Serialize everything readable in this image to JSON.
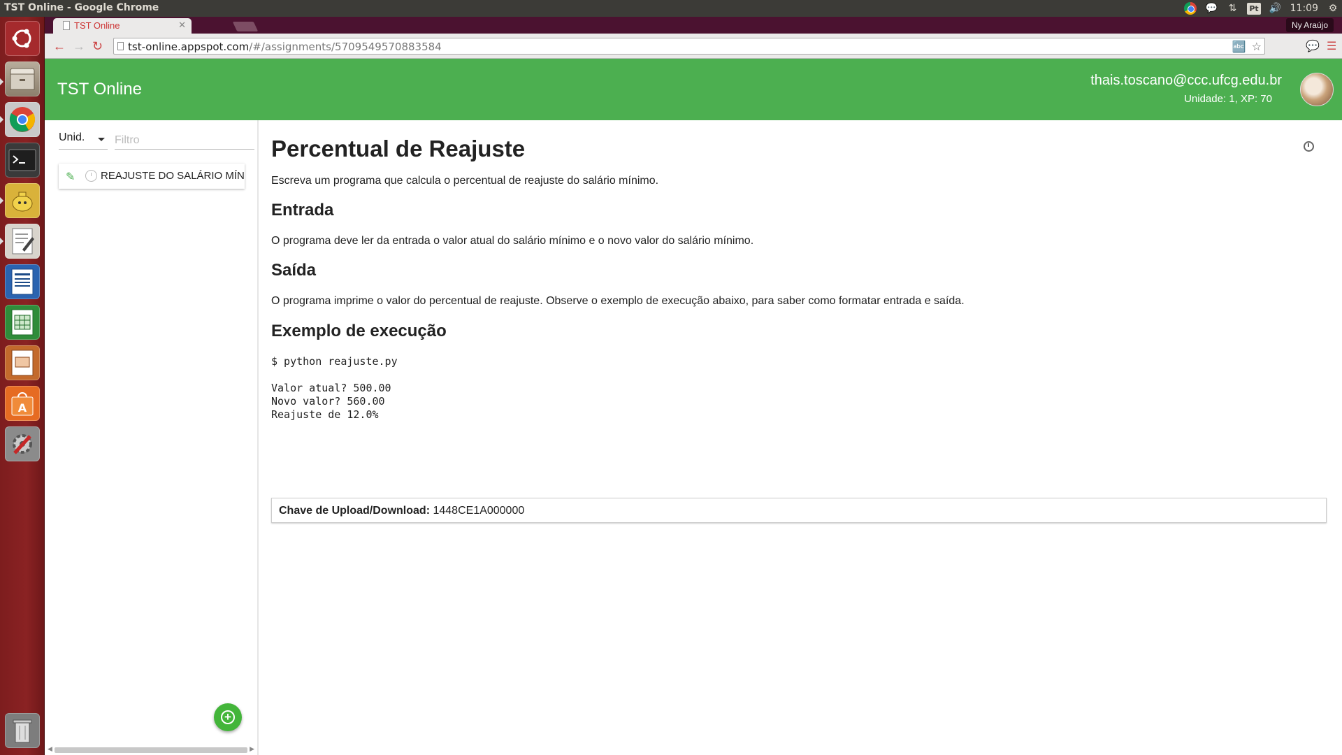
{
  "os_panel": {
    "window_title": "TST Online - Google Chrome",
    "lang_indicator": "Pt",
    "clock": "11:09"
  },
  "launcher": {
    "apps": [
      {
        "name": "ubuntu-dash",
        "color": "#a02528"
      },
      {
        "name": "files",
        "color": "#8b7d6b"
      },
      {
        "name": "chrome",
        "color": "#2a6ac0"
      },
      {
        "name": "terminal",
        "color": "#2b2b2b"
      },
      {
        "name": "tea-app",
        "color": "#d6a928"
      },
      {
        "name": "text-editor",
        "color": "#d9d6cf"
      },
      {
        "name": "writer",
        "color": "#1f5aa6"
      },
      {
        "name": "calc",
        "color": "#2d8a36"
      },
      {
        "name": "impress",
        "color": "#c2642a"
      },
      {
        "name": "software-center",
        "color": "#e06a25"
      },
      {
        "name": "system-settings",
        "color": "#7a7a7a"
      },
      {
        "name": "trash",
        "color": "#9a9a9a"
      }
    ]
  },
  "browser": {
    "tab_title": "TST Online",
    "profile_name": "Ny Araújo",
    "url_host": "tst-online.appspot.com",
    "url_path": "/#/assignments/5709549570883584"
  },
  "app": {
    "title": "TST Online",
    "user_email": "thais.toscano@ccc.ufcg.edu.br",
    "user_stats": "Unidade: 1, XP: 70",
    "accent_color": "#4caf50"
  },
  "sidebar": {
    "unit_select_label": "Unid.",
    "filter_placeholder": "Filtro",
    "tasks": [
      {
        "label": "REAJUSTE DO SALÁRIO MÍNIM"
      }
    ]
  },
  "assignment": {
    "title": "Percentual de Reajuste",
    "description": "Escreva um programa que calcula o percentual de reajuste do salário mínimo.",
    "input_heading": "Entrada",
    "input_text": "O programa deve ler da entrada o valor atual do salário mínimo e o novo valor do salário mínimo.",
    "output_heading": "Saída",
    "output_text": "O programa imprime o valor do percentual de reajuste. Observe o exemplo de execução abaixo, para saber como formatar entrada e saída.",
    "example_heading": "Exemplo de execução",
    "example_code": "$ python reajuste.py\n\nValor atual? 500.00\nNovo valor? 560.00\nReajuste de 12.0%",
    "key_label": "Chave de Upload/Download:",
    "key_value": "1448CE1A000000"
  }
}
